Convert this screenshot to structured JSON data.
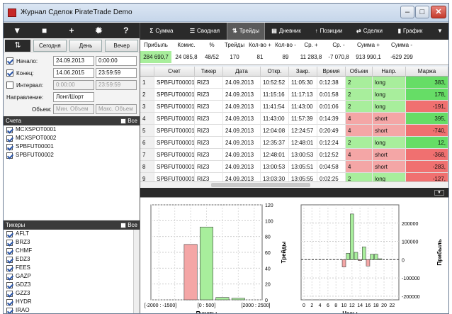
{
  "window": {
    "title": "Журнал Сделок PirateTrade Demo"
  },
  "left": {
    "toolbar_icons": [
      "filter-icon",
      "lock-icon",
      "add-icon",
      "gear-icon",
      "help-icon"
    ],
    "sync_label": "⇅",
    "period_buttons": [
      "Сегодня",
      "День",
      "Вечер"
    ],
    "start": {
      "label": "Начало:",
      "date": "24.09.2013",
      "time": "0:00:00",
      "checked": true
    },
    "end": {
      "label": "Конец:",
      "date": "14.06.2015",
      "time": "23:59:59",
      "checked": true
    },
    "interval": {
      "label": "Интервал:",
      "from": "0:00:00",
      "to": "23:59:59",
      "checked": false
    },
    "direction": {
      "label": "Направление:",
      "value": "Лонг/Шорт"
    },
    "volume": {
      "label": "Объем:",
      "min_placeholder": "Мин. Объем",
      "max_placeholder": "Макс. Объем"
    },
    "accounts": {
      "title": "Счета",
      "all_label": "Все",
      "items": [
        "MCXSPOT0001",
        "MCXSPOT0002",
        "SPBFUT00001",
        "SPBFUT00002"
      ]
    },
    "tickers": {
      "title": "Тикеры",
      "all_label": "Все",
      "items": [
        "AFLT",
        "BRZ3",
        "CHMF",
        "EDZ3",
        "FEES",
        "GAZP",
        "GDZ3",
        "GZZ3",
        "HYDR",
        "IRAO"
      ]
    }
  },
  "tabs": [
    {
      "icon": "Σ",
      "label": "Сумма",
      "active": false
    },
    {
      "icon": "☰",
      "label": "Сводная",
      "active": false
    },
    {
      "icon": "⇅",
      "label": "Трейды",
      "active": true
    },
    {
      "icon": "▤",
      "label": "Дневник",
      "active": false
    },
    {
      "icon": "↑",
      "label": "Позиции",
      "active": false
    },
    {
      "icon": "⇄",
      "label": "Сделки",
      "active": false
    },
    {
      "icon": "▮",
      "label": "График",
      "active": false
    }
  ],
  "tab_overflow": "▼",
  "summary": {
    "headers": [
      "Прибыль",
      "Комис.",
      "%",
      "Трейды",
      "Кол-во +",
      "Кол-во -",
      "Ср. +",
      "Ср. -",
      "Сумма +",
      "Сумма -"
    ],
    "values": [
      "284 690,7",
      "24 085,8",
      "48/52",
      "170",
      "81",
      "89",
      "11 283,8",
      "-7 070,8",
      "913 990,1",
      "-629 299"
    ]
  },
  "grid": {
    "headers": [
      "",
      "Счет",
      "Тикер",
      "Дата",
      "Откр.",
      "Закр.",
      "Время",
      "Объем",
      "Напр.",
      "Маржа"
    ],
    "rows": [
      [
        "1",
        "SPBFUT00001",
        "RIZ3",
        "24.09.2013",
        "10:52:52",
        "11:05:30",
        "0:12:38",
        "2",
        "long",
        "383,"
      ],
      [
        "2",
        "SPBFUT00001",
        "RIZ3",
        "24.09.2013",
        "11:15:16",
        "11:17:13",
        "0:01:58",
        "2",
        "long",
        "178,"
      ],
      [
        "3",
        "SPBFUT00001",
        "RIZ3",
        "24.09.2013",
        "11:41:54",
        "11:43:00",
        "0:01:06",
        "2",
        "long",
        "-191,"
      ],
      [
        "4",
        "SPBFUT00001",
        "RIZ3",
        "24.09.2013",
        "11:43:00",
        "11:57:39",
        "0:14:39",
        "4",
        "short",
        "395,"
      ],
      [
        "5",
        "SPBFUT00001",
        "RIZ3",
        "24.09.2013",
        "12:04:08",
        "12:24:57",
        "0:20:49",
        "4",
        "short",
        "-740,"
      ],
      [
        "6",
        "SPBFUT00001",
        "RIZ3",
        "24.09.2013",
        "12:35:37",
        "12:48:01",
        "0:12:24",
        "2",
        "long",
        "12,"
      ],
      [
        "7",
        "SPBFUT00001",
        "RIZ3",
        "24.09.2013",
        "12:48:01",
        "13:00:53",
        "0:12:52",
        "4",
        "short",
        "-368,"
      ],
      [
        "8",
        "SPBFUT00001",
        "RIZ3",
        "24.09.2013",
        "13:00:53",
        "13:05:51",
        "0:04:58",
        "4",
        "short",
        "-283,"
      ],
      [
        "9",
        "SPBFUT00001",
        "RIZ3",
        "24.09.2013",
        "13:03:30",
        "13:05:55",
        "0:02:25",
        "2",
        "long",
        "-127,"
      ]
    ]
  },
  "colors": {
    "green": "#a8ee9c",
    "red": "#f4a6a6",
    "dark": "#2a2a2a"
  },
  "chart_data": [
    {
      "type": "bar",
      "categories": [
        "[-2000 : -1500]",
        "",
        "",
        "[0 : 500]",
        "",
        "",
        "[2000 : 2500]"
      ],
      "values": [
        0,
        0,
        70,
        92,
        3,
        2,
        0
      ],
      "xlabel": "Пункты",
      "ylabel": "Трейды",
      "ylim": [
        0,
        120
      ],
      "yticks": [
        "0",
        "20",
        "40",
        "60",
        "80",
        "100",
        "120"
      ]
    },
    {
      "type": "bar",
      "categories": [
        "0",
        "2",
        "4",
        "6",
        "8",
        "10",
        "12",
        "14",
        "16",
        "18",
        "20",
        "22"
      ],
      "x": [
        10,
        11,
        12,
        13,
        14,
        15,
        16,
        17,
        18,
        19
      ],
      "values": [
        -40000,
        35000,
        250000,
        40000,
        -5000,
        70000,
        -35000,
        30000,
        30000,
        5000
      ],
      "xlabel": "Часы",
      "ylabel": "Прибыль",
      "ylim": [
        -220000,
        300000
      ],
      "yticks": [
        "-200000",
        "-100000",
        "0",
        "100000",
        "200000"
      ]
    }
  ]
}
